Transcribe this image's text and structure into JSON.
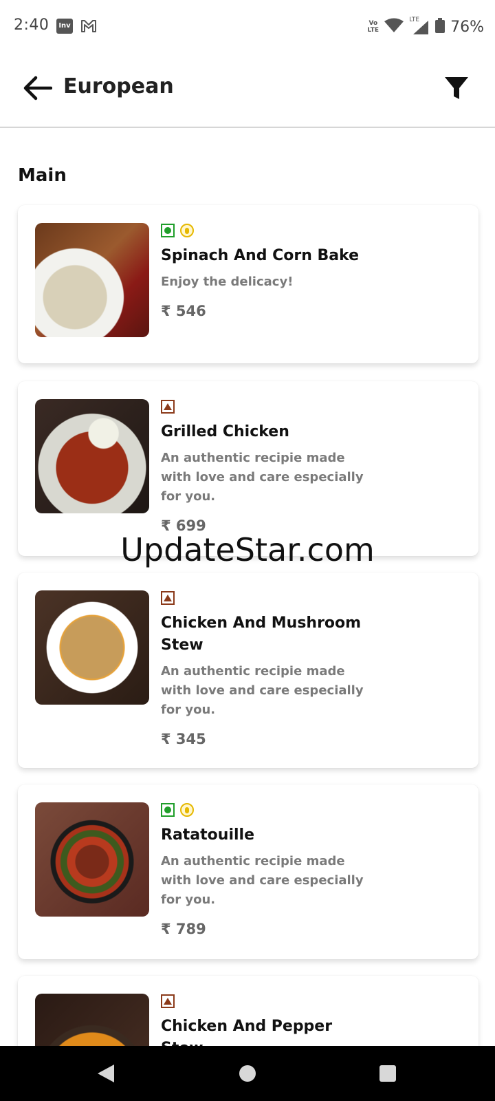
{
  "status_bar": {
    "time": "2:40",
    "inv_icon_text": "Inv",
    "volte_top": "Vo",
    "volte_bottom": "LTE",
    "lte_label": "LTE",
    "battery": "76%"
  },
  "header": {
    "title": "European"
  },
  "section": {
    "title": "Main"
  },
  "items": [
    {
      "name": "Spinach And Corn Bake",
      "desc": "Enjoy the delicacy!",
      "price": "₹ 546",
      "type": "veg",
      "jain": true
    },
    {
      "name": "Grilled Chicken",
      "desc": "An authentic recipie made with love and care especially for you.",
      "price": "₹ 699",
      "type": "non-veg",
      "jain": false
    },
    {
      "name": "Chicken And Mushroom Stew",
      "desc": "An authentic recipie made with love and care especially for you.",
      "price": "₹ 345",
      "type": "non-veg",
      "jain": false
    },
    {
      "name": "Ratatouille",
      "desc": "An authentic recipie made with love and care especially for you.",
      "price": "₹ 789",
      "type": "veg",
      "jain": true
    },
    {
      "name": "Chicken And Pepper Stew",
      "desc": "",
      "price": "",
      "type": "non-veg",
      "jain": false
    }
  ],
  "watermark": "UpdateStar.com",
  "colors": {
    "veg": "#1f9e2a",
    "non_veg": "#8b3a1a",
    "jain": "#e6b800",
    "desc_text": "#7a7a7a",
    "price_text": "#666666"
  }
}
